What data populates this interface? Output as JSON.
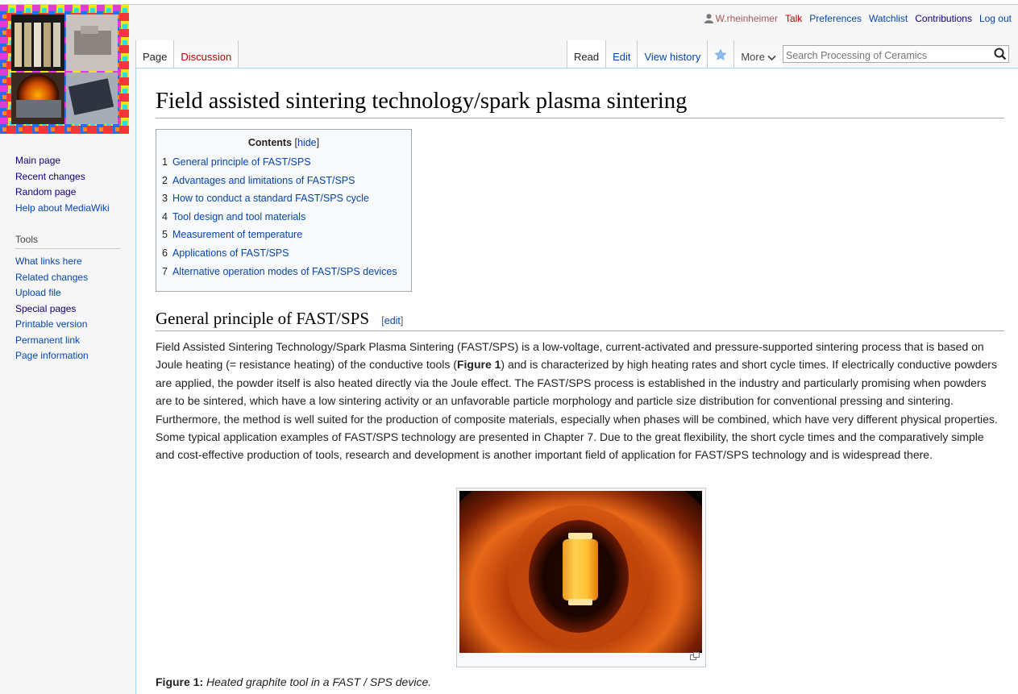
{
  "personal": {
    "username": "W.rheinheimer",
    "items": [
      "Talk",
      "Preferences",
      "Watchlist",
      "Contributions",
      "Log out"
    ]
  },
  "tabs": {
    "page": "Page",
    "discussion": "Discussion",
    "read": "Read",
    "edit": "Edit",
    "history": "View history",
    "more": "More"
  },
  "search": {
    "placeholder": "Search Processing of Ceramics"
  },
  "nav": {
    "items": [
      "Main page",
      "Recent changes",
      "Random page",
      "Help about MediaWiki"
    ],
    "tools_title": "Tools",
    "tools": [
      "What links here",
      "Related changes",
      "Upload file",
      "Special pages",
      "Printable version",
      "Permanent link",
      "Page information"
    ]
  },
  "article": {
    "title": "Field assisted sintering technology/spark plasma sintering",
    "toc": {
      "title": "Contents",
      "hide": "hide",
      "items": [
        {
          "num": "1",
          "text": "General principle of FAST/SPS"
        },
        {
          "num": "2",
          "text": "Advantages and limitations of FAST/SPS"
        },
        {
          "num": "3",
          "text": "How to conduct a standard FAST/SPS cycle"
        },
        {
          "num": "4",
          "text": "Tool design and tool materials"
        },
        {
          "num": "5",
          "text": "Measurement of temperature"
        },
        {
          "num": "6",
          "text": "Applications of FAST/SPS"
        },
        {
          "num": "7",
          "text": "Alternative operation modes of FAST/SPS devices"
        }
      ]
    },
    "section1": {
      "heading": "General principle of FAST/SPS",
      "edit": "edit",
      "para_a": "Field Assisted Sintering Technology/Spark Plasma Sintering (FAST/SPS) is a low-voltage, current-activated and pressure-supported sintering process that is based on Joule heating (= resistance heating) of the conductive tools (",
      "para_bold": "Figure 1",
      "para_b": ") and is characterized by high heating rates and short cycle times. If electrically conductive powders are applied, the powder itself is also heated directly via the Joule effect. The FAST/SPS process is established in the industry and particularly promising when powders are to be sintered, which have a low sintering activity or an unfavorable particle morphology and particle size distribution for conventional pressing and sintering. Furthermore, the method is well suited for the production of composite materials, especially when phases will be combined, which have very different physical properties. Some typical application examples of FAST/SPS technology are presented in Chapter 7. Due to the great flexibility, the short cycle times and the comparatively simple and cost-effective production of tools, research and development is another important field of application for FAST/SPS technology and is widespread there."
    },
    "figure": {
      "label": "Figure 1:",
      "caption": "Heated graphite tool in a FAST / SPS device."
    }
  }
}
